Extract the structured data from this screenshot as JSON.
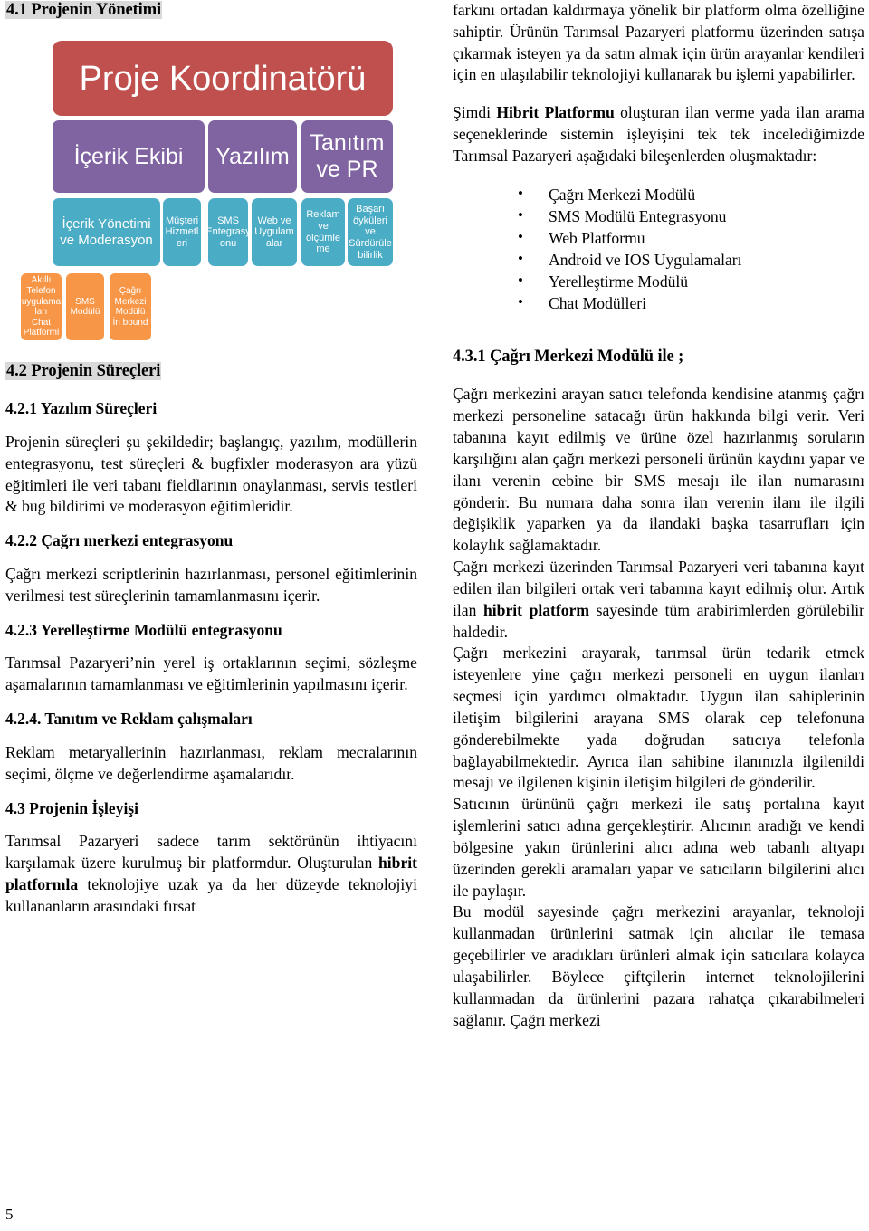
{
  "page": {
    "number": "5"
  },
  "left_column": {
    "heading_41": "4.1 Projenin Yönetimi",
    "org_chart": {
      "level1": [
        {
          "label": "Proje Koordinatörü",
          "color": "#c0504d"
        }
      ],
      "level2": [
        {
          "label": "İçerik Ekibi",
          "color": "#8064a2"
        },
        {
          "label": "Yazılım",
          "color": "#8064a2"
        },
        {
          "label": "Tanıtım ve PR",
          "color": "#8064a2"
        }
      ],
      "level3": [
        {
          "label": "İçerik Yönetimi ve Moderasyon",
          "color": "#4bacc6"
        },
        {
          "label": "Müşteri Hizmetl eri",
          "color": "#4bacc6"
        },
        {
          "label": "SMS Entegrasy onu",
          "color": "#4bacc6"
        },
        {
          "label": "Web ve Uygulam alar",
          "color": "#4bacc6"
        },
        {
          "label": "Reklam ve ölçümle me",
          "color": "#4bacc6"
        },
        {
          "label": "Başarı öyküleri ve Sürdürüle bilirlik",
          "color": "#4bacc6"
        }
      ],
      "level4": [
        {
          "label": "Akıllı Telefon uygulama ları\nChat Platforml",
          "color": "#f79646"
        },
        {
          "label": "SMS Modülü",
          "color": "#f79646"
        },
        {
          "label": "Çağrı Merkezi Modülü\nİn bound",
          "color": "#f79646"
        }
      ]
    },
    "heading_42": "4.2 Projenin Süreçleri",
    "heading_421": "4.2.1 Yazılım Süreçleri",
    "para_421": "Projenin süreçleri şu şekildedir; başlangıç, yazılım, modüllerin entegrasyonu, test süreçleri & bugfixler moderasyon ara yüzü eğitimleri ile veri tabanı fieldlarının onaylanması, servis testleri & bug bildirimi ve moderasyon eğitimleridir.",
    "heading_422": "4.2.2 Çağrı merkezi entegrasyonu",
    "para_422": "Çağrı merkezi scriptlerinin hazırlanması, personel eğitimlerinin verilmesi test süreçlerinin tamamlanmasını içerir.",
    "heading_423": "4.2.3 Yerelleştirme Modülü entegrasyonu",
    "para_423": "Tarımsal Pazaryeri’nin yerel iş ortaklarının seçimi, sözleşme aşamalarının tamamlanması ve eğitimlerinin yapılmasını içerir.",
    "heading_424": "4.2.4. Tanıtım ve Reklam çalışmaları",
    "para_424": "Reklam metaryallerinin hazırlanması, reklam mecralarının seçimi, ölçme ve değerlendirme aşamalarıdır.",
    "heading_43": "4.3 Projenin İşleyişi",
    "para_43_a": "Tarımsal Pazaryeri sadece tarım sektörünün ihtiyacını karşılamak üzere kurulmuş bir platformdur. Oluşturulan ",
    "para_43_bold": "hibrit platformla",
    "para_43_b": " teknolojiye uzak ya da her düzeyde teknolojiyi kullananların arasındaki fırsat"
  },
  "right_column": {
    "para_top_a": "farkını ortadan kaldırmaya yönelik bir platform olma özelliğine sahiptir. Ürünün Tarımsal Pazaryeri platformu üzerinden satışa çıkarmak isteyen ya da satın almak için ürün arayanlar kendileri için en ulaşılabilir teknolojiyi kullanarak bu işlemi yapabilirler.",
    "para_top_b_pre": "Şimdi ",
    "para_top_b_bold": "Hibrit Platformu",
    "para_top_b_post": " oluşturan ilan verme yada ilan arama seçeneklerinde sistemin işleyişini tek tek incelediğimizde Tarımsal Pazaryeri aşağıdaki bileşenlerden oluşmaktadır:",
    "bullets": [
      "Çağrı Merkezi Modülü",
      "SMS Modülü Entegrasyonu",
      "Web Platformu",
      "Android ve IOS Uygulamaları",
      "Yerelleştirme Modülü",
      "Chat Modülleri"
    ],
    "heading_431": "4.3.1 Çağrı Merkezi Modülü ile ;",
    "para_431_a": "Çağrı merkezini arayan satıcı telefonda kendisine atanmış çağrı merkezi personeline satacağı ürün hakkında bilgi verir. Veri tabanına kayıt edilmiş ve ürüne özel hazırlanmış soruların karşılığını alan çağrı merkezi personeli ürünün kaydını yapar ve ilanı verenin cebine bir SMS mesajı ile ilan numarasını gönderir. Bu numara daha sonra ilan verenin ilanı ile ilgili değişiklik yaparken ya da ilandaki başka tasarrufları için kolaylık sağlamaktadır.",
    "para_431_b_pre": "Çağrı merkezi üzerinden Tarımsal Pazaryeri veri tabanına kayıt edilen ilan bilgileri ortak veri tabanına kayıt edilmiş olur. Artık ilan ",
    "para_431_b_bold": "hibrit platform",
    "para_431_b_post": " sayesinde tüm arabirimlerden görülebilir haldedir.",
    "para_431_c": "Çağrı merkezini arayarak, tarımsal ürün tedarik etmek isteyenlere yine çağrı merkezi personeli en uygun ilanları seçmesi için yardımcı olmaktadır. Uygun ilan sahiplerinin iletişim bilgilerini arayana SMS olarak cep telefonuna gönderebilmekte yada doğrudan satıcıya telefonla bağlayabilmektedir. Ayrıca ilan sahibine ilanınızla ilgilenildi mesajı ve ilgilenen kişinin iletişim bilgileri de gönderilir.",
    "para_431_d": "Satıcının ürününü çağrı merkezi ile satış portalına kayıt işlemlerini satıcı adına gerçekleştirir. Alıcının aradığı ve kendi bölgesine yakın ürünlerini alıcı adına web tabanlı altyapı üzerinden gerekli aramaları yapar ve satıcıların bilgilerini alıcı ile paylaşır.",
    "para_431_e": "Bu modül sayesinde çağrı merkezini arayanlar, teknoloji kullanmadan ürünlerini satmak için alıcılar ile temasa geçebilirler ve aradıkları ürünleri almak için satıcılara kolayca ulaşabilirler. Böylece çiftçilerin internet teknolojilerini kullanmadan da ürünlerini pazara rahatça çıkarabilmeleri sağlanır. Çağrı merkezi"
  },
  "colors": {
    "level1": "#c0504d",
    "level2": "#8064a2",
    "level3": "#4bacc6",
    "level4": "#f79646",
    "heading_highlight": "#d9d9d9"
  }
}
